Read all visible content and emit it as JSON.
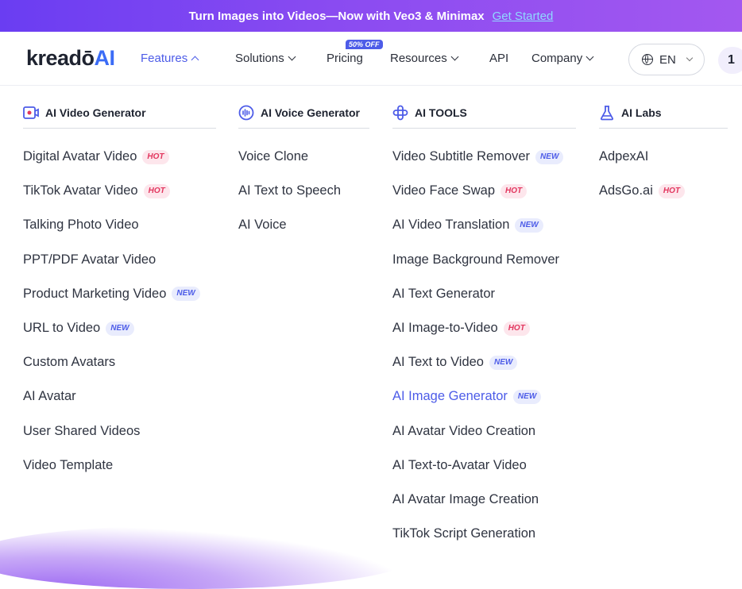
{
  "banner": {
    "text": "Turn Images into Videos—Now with Veo3 & Minimax",
    "cta": "Get Started"
  },
  "logo": {
    "part1": "kreadō",
    "part2": "AI"
  },
  "nav": {
    "features": "Features",
    "solutions": "Solutions",
    "pricing": "Pricing",
    "pricing_badge": "50% OFF",
    "resources": "Resources",
    "api": "API",
    "company": "Company",
    "language": "EN",
    "notification_count": "1"
  },
  "columns": [
    {
      "title": "AI Video Generator",
      "icon": "video-camera-icon",
      "items": [
        {
          "label": "Digital Avatar Video",
          "tag": "HOT"
        },
        {
          "label": "TikTok Avatar Video",
          "tag": "HOT"
        },
        {
          "label": "Talking Photo Video",
          "tag": ""
        },
        {
          "label": "PPT/PDF Avatar Video",
          "tag": ""
        },
        {
          "label": "Product Marketing Video",
          "tag": "NEW"
        },
        {
          "label": "URL to Video",
          "tag": "NEW"
        },
        {
          "label": "Custom Avatars",
          "tag": ""
        },
        {
          "label": "AI Avatar",
          "tag": ""
        },
        {
          "label": "User Shared Videos",
          "tag": ""
        },
        {
          "label": "Video Template",
          "tag": ""
        }
      ]
    },
    {
      "title": "AI Voice Generator",
      "icon": "voice-wave-icon",
      "items": [
        {
          "label": "Voice Clone",
          "tag": ""
        },
        {
          "label": "AI Text to Speech",
          "tag": ""
        },
        {
          "label": "AI Voice",
          "tag": ""
        }
      ]
    },
    {
      "title": "AI TOOLS",
      "icon": "tools-cross-icon",
      "items": [
        {
          "label": "Video Subtitle Remover",
          "tag": "NEW"
        },
        {
          "label": "Video Face Swap",
          "tag": "HOT"
        },
        {
          "label": "AI Video Translation",
          "tag": "NEW"
        },
        {
          "label": "Image Background Remover",
          "tag": ""
        },
        {
          "label": "AI Text Generator",
          "tag": ""
        },
        {
          "label": "AI Image-to-Video",
          "tag": "HOT"
        },
        {
          "label": "AI Text to Video",
          "tag": "NEW"
        },
        {
          "label": "AI Image Generator",
          "tag": "NEW"
        },
        {
          "label": "AI Avatar Video Creation",
          "tag": ""
        },
        {
          "label": "AI Text-to-Avatar Video",
          "tag": ""
        },
        {
          "label": "AI Avatar Image Creation",
          "tag": ""
        },
        {
          "label": "TikTok Script Generation",
          "tag": ""
        }
      ]
    },
    {
      "title": "AI Labs",
      "icon": "flask-icon",
      "items": [
        {
          "label": "AdpexAI",
          "tag": ""
        },
        {
          "label": "AdsGo.ai",
          "tag": "HOT"
        }
      ]
    }
  ],
  "colors": {
    "accent": "#4d5ce8",
    "hot_text": "#e2365e",
    "hot_bg": "#fde6ec",
    "new_bg": "#e9ecfd"
  }
}
